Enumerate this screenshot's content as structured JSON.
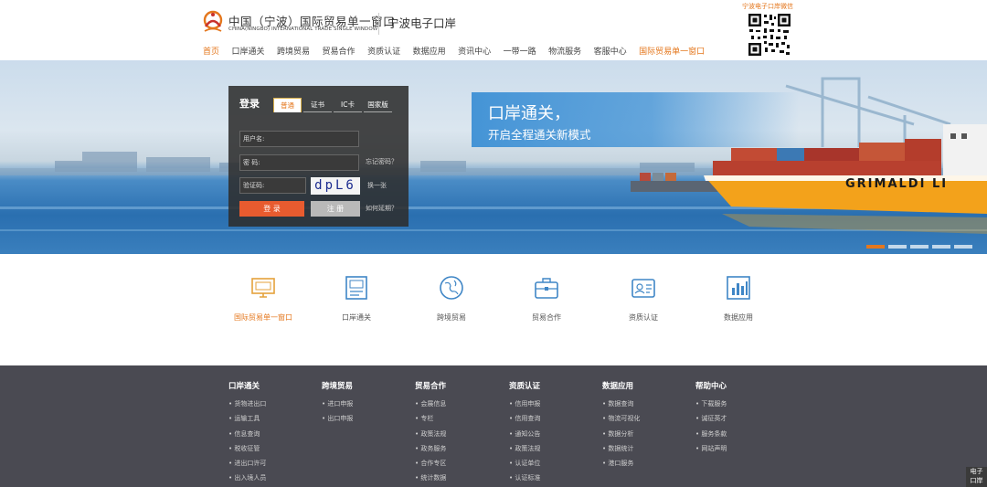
{
  "header": {
    "title": "中国（宁波）国际贸易单一窗口",
    "subtitle": "CHINA(NINGBO) INTERNATIONAL TRADE SINGLE WINDOW",
    "brand": "宁波电子口岸",
    "qr_caption": "宁波电子口岸微信"
  },
  "nav": [
    {
      "label": "首页"
    },
    {
      "label": "口岸通关"
    },
    {
      "label": "跨境贸易"
    },
    {
      "label": "贸易合作"
    },
    {
      "label": "资质认证"
    },
    {
      "label": "数据应用"
    },
    {
      "label": "资讯中心"
    },
    {
      "label": "一带一路"
    },
    {
      "label": "物流服务"
    },
    {
      "label": "客服中心"
    },
    {
      "label": "国际贸易单一窗口"
    }
  ],
  "login": {
    "title": "登录",
    "tabs": [
      "普通",
      "证书",
      "IC卡",
      "国家版"
    ],
    "username_placeholder": "用户名:",
    "password_placeholder": "密  码:",
    "captcha_placeholder": "验证码:",
    "forgot_password": "忘记密码？",
    "captcha_text": "dpL6",
    "refresh_captcha": "换一张",
    "login_button": "登 录",
    "register_button": "注 册",
    "how_to_renew": "如何延期？"
  },
  "slogan": {
    "line1": "口岸通关，",
    "line2": "开启全程通关新模式"
  },
  "ship_name": "GRIMALDI LI",
  "services": [
    {
      "label": "国际贸易单一窗口",
      "icon": "monitor-icon"
    },
    {
      "label": "口岸通关",
      "icon": "document-icon"
    },
    {
      "label": "跨境贸易",
      "icon": "globe-icon"
    },
    {
      "label": "贸易合作",
      "icon": "briefcase-icon"
    },
    {
      "label": "资质认证",
      "icon": "id-card-icon"
    },
    {
      "label": "数据应用",
      "icon": "bar-chart-icon"
    }
  ],
  "footer": {
    "columns": [
      {
        "heading": "口岸通关",
        "links": [
          "货物进出口",
          "运输工具",
          "信息查询",
          "税收征管",
          "进出口许可",
          "出入境人员"
        ]
      },
      {
        "heading": "跨境贸易",
        "links": [
          "进口申报",
          "出口申报"
        ]
      },
      {
        "heading": "贸易合作",
        "links": [
          "会展信息",
          "专栏",
          "政策法规",
          "政务服务",
          "合作专区",
          "统计数据"
        ]
      },
      {
        "heading": "资质认证",
        "links": [
          "信用申报",
          "信用查询",
          "通知公告",
          "政策法规",
          "认证单位",
          "认证标准"
        ]
      },
      {
        "heading": "数据应用",
        "links": [
          "数据查询",
          "物流可视化",
          "数据分析",
          "数据统计",
          "港口服务"
        ]
      },
      {
        "heading": "帮助中心",
        "links": [
          "下载服务",
          "诚征英才",
          "服务条款",
          "网站声明"
        ]
      }
    ]
  },
  "side_tab": [
    "电子",
    "口岸"
  ],
  "colors": {
    "accent": "#e4771d",
    "login_button": "#e85b2f",
    "footer_bg": "#4a4a52",
    "slogan_bg": "#3d90d5"
  }
}
